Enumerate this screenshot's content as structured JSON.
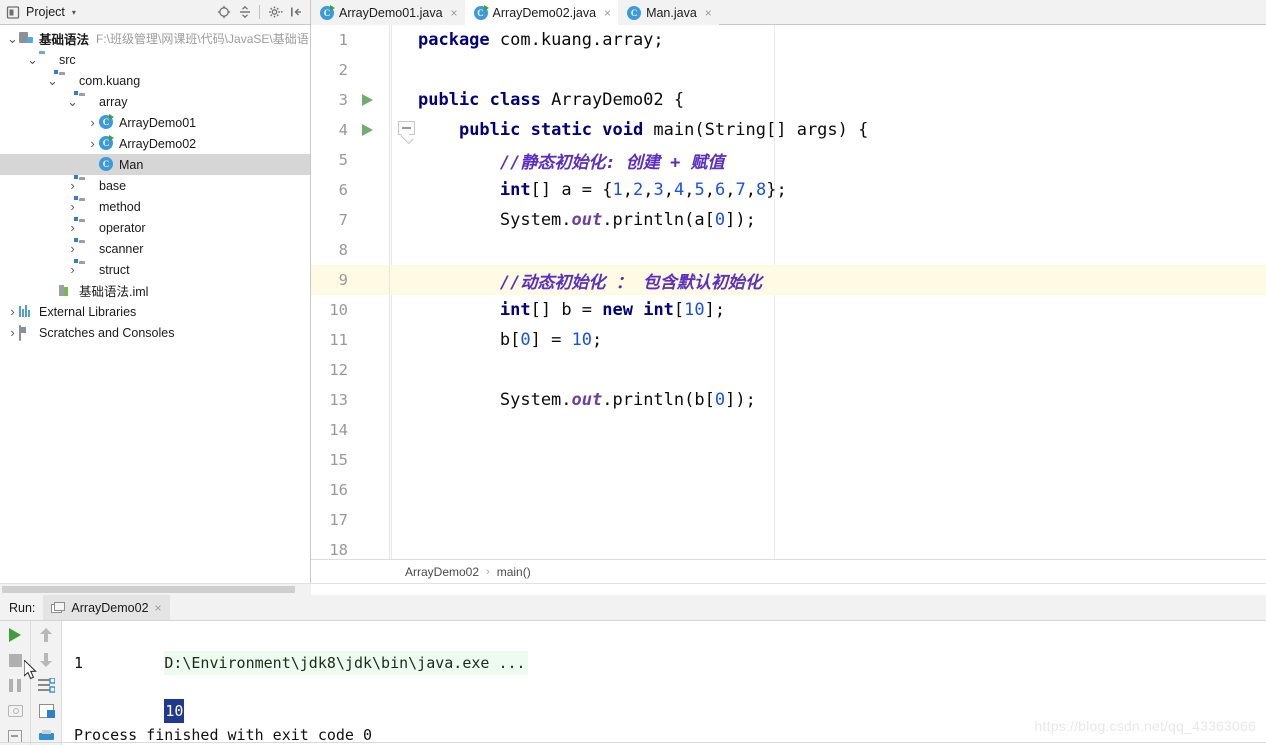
{
  "project_panel": {
    "title": "Project",
    "caret": "▾",
    "icons": [
      "project-view-icon",
      "locate-icon",
      "collapse-all-icon",
      "settings-gear-icon",
      "hide-panel-icon"
    ],
    "tree": [
      {
        "label": "基础语法",
        "path": "F:\\班级管理\\网课班\\代码\\JavaSE\\基础语",
        "icon": "project-root-icon",
        "arrow": "⌄",
        "depth": 0,
        "bold": true,
        "selected": false
      },
      {
        "label": "src",
        "icon": "source-folder-icon",
        "arrow": "⌄",
        "depth": 1,
        "bold": false,
        "selected": false
      },
      {
        "label": "com.kuang",
        "icon": "package-icon",
        "arrow": "⌄",
        "depth": 2,
        "bold": false,
        "selected": false
      },
      {
        "label": "array",
        "icon": "package-icon",
        "arrow": "⌄",
        "depth": 3,
        "bold": false,
        "selected": false
      },
      {
        "label": "ArrayDemo01",
        "icon": "java-class-runnable-icon",
        "arrow": "›",
        "depth": 4,
        "bold": false,
        "selected": false
      },
      {
        "label": "ArrayDemo02",
        "icon": "java-class-runnable-icon",
        "arrow": "›",
        "depth": 4,
        "bold": false,
        "selected": false
      },
      {
        "label": "Man",
        "icon": "java-class-icon",
        "arrow": "",
        "depth": 4,
        "bold": false,
        "selected": true
      },
      {
        "label": "base",
        "icon": "package-icon",
        "arrow": "›",
        "depth": 3,
        "bold": false,
        "selected": false
      },
      {
        "label": "method",
        "icon": "package-icon",
        "arrow": "›",
        "depth": 3,
        "bold": false,
        "selected": false
      },
      {
        "label": "operator",
        "icon": "package-icon",
        "arrow": "›",
        "depth": 3,
        "bold": false,
        "selected": false
      },
      {
        "label": "scanner",
        "icon": "package-icon",
        "arrow": "›",
        "depth": 3,
        "bold": false,
        "selected": false
      },
      {
        "label": "struct",
        "icon": "package-icon",
        "arrow": "›",
        "depth": 3,
        "bold": false,
        "selected": false
      },
      {
        "label": "基础语法.iml",
        "icon": "iml-file-icon",
        "arrow": "",
        "depth": 2,
        "bold": false,
        "selected": false
      },
      {
        "label": "External Libraries",
        "icon": "libraries-icon",
        "arrow": "›",
        "depth": 0,
        "bold": false,
        "selected": false
      },
      {
        "label": "Scratches and Consoles",
        "icon": "scratches-icon",
        "arrow": "›",
        "depth": 0,
        "bold": false,
        "selected": false
      }
    ]
  },
  "editor_tabs": [
    {
      "label": "ArrayDemo01.java",
      "icon": "java-class-runnable-icon",
      "active": false,
      "close": "×"
    },
    {
      "label": "ArrayDemo02.java",
      "icon": "java-class-runnable-icon",
      "active": true,
      "close": "×"
    },
    {
      "label": "Man.java",
      "icon": "java-class-icon",
      "active": false,
      "close": "×"
    }
  ],
  "editor": {
    "current_line": 9,
    "line_numbers": [
      "1",
      "2",
      "3",
      "4",
      "5",
      "6",
      "7",
      "8",
      "9",
      "10",
      "11",
      "12",
      "13",
      "14",
      "15",
      "16",
      "17",
      "18"
    ],
    "run_markers": [
      3,
      4
    ],
    "fold_marker_line": 4,
    "lines": [
      {
        "n": "1",
        "tokens": [
          {
            "t": "package ",
            "c": "kw"
          },
          {
            "t": "com.kuang.array;",
            "c": ""
          }
        ]
      },
      {
        "n": "2",
        "tokens": []
      },
      {
        "n": "3",
        "tokens": [
          {
            "t": "public class ",
            "c": "kw"
          },
          {
            "t": "ArrayDemo02 {",
            "c": ""
          }
        ]
      },
      {
        "n": "4",
        "tokens": [
          {
            "t": "    ",
            "c": ""
          },
          {
            "t": "public static void ",
            "c": "kw"
          },
          {
            "t": "main(String[] args) {",
            "c": ""
          }
        ]
      },
      {
        "n": "5",
        "tokens": [
          {
            "t": "        ",
            "c": ""
          },
          {
            "t": "//静态初始化: 创建 + 赋值",
            "c": "cmt"
          }
        ]
      },
      {
        "n": "6",
        "tokens": [
          {
            "t": "        ",
            "c": ""
          },
          {
            "t": "int",
            "c": "kw"
          },
          {
            "t": "[] a = {",
            "c": ""
          },
          {
            "t": "1",
            "c": "num"
          },
          {
            "t": ",",
            "c": ""
          },
          {
            "t": "2",
            "c": "num"
          },
          {
            "t": ",",
            "c": ""
          },
          {
            "t": "3",
            "c": "num"
          },
          {
            "t": ",",
            "c": ""
          },
          {
            "t": "4",
            "c": "num"
          },
          {
            "t": ",",
            "c": ""
          },
          {
            "t": "5",
            "c": "num"
          },
          {
            "t": ",",
            "c": ""
          },
          {
            "t": "6",
            "c": "num"
          },
          {
            "t": ",",
            "c": ""
          },
          {
            "t": "7",
            "c": "num"
          },
          {
            "t": ",",
            "c": ""
          },
          {
            "t": "8",
            "c": "num"
          },
          {
            "t": "};",
            "c": ""
          }
        ]
      },
      {
        "n": "7",
        "tokens": [
          {
            "t": "        System.",
            "c": ""
          },
          {
            "t": "out",
            "c": "fld"
          },
          {
            "t": ".println(a[",
            "c": ""
          },
          {
            "t": "0",
            "c": "num"
          },
          {
            "t": "]);",
            "c": ""
          }
        ]
      },
      {
        "n": "8",
        "tokens": []
      },
      {
        "n": "9",
        "tokens": [
          {
            "t": "        ",
            "c": ""
          },
          {
            "t": "//动态初始化 ： 包含默认初始化",
            "c": "cmt"
          }
        ]
      },
      {
        "n": "10",
        "tokens": [
          {
            "t": "        ",
            "c": ""
          },
          {
            "t": "int",
            "c": "kw"
          },
          {
            "t": "[] b = ",
            "c": ""
          },
          {
            "t": "new int",
            "c": "kw"
          },
          {
            "t": "[",
            "c": ""
          },
          {
            "t": "10",
            "c": "num"
          },
          {
            "t": "];",
            "c": ""
          }
        ]
      },
      {
        "n": "11",
        "tokens": [
          {
            "t": "        b[",
            "c": ""
          },
          {
            "t": "0",
            "c": "num"
          },
          {
            "t": "] = ",
            "c": ""
          },
          {
            "t": "10",
            "c": "num"
          },
          {
            "t": ";",
            "c": ""
          }
        ]
      },
      {
        "n": "12",
        "tokens": []
      },
      {
        "n": "13",
        "tokens": [
          {
            "t": "        System.",
            "c": ""
          },
          {
            "t": "out",
            "c": "fld"
          },
          {
            "t": ".println(b[",
            "c": ""
          },
          {
            "t": "0",
            "c": "num"
          },
          {
            "t": "]);",
            "c": ""
          }
        ]
      },
      {
        "n": "14",
        "tokens": []
      },
      {
        "n": "15",
        "tokens": []
      },
      {
        "n": "16",
        "tokens": []
      },
      {
        "n": "17",
        "tokens": []
      },
      {
        "n": "18",
        "tokens": []
      }
    ],
    "breadcrumb": {
      "class": "ArrayDemo02",
      "separator": "›",
      "method": "main()"
    }
  },
  "run_panel": {
    "label": "Run:",
    "tab": {
      "label": "ArrayDemo02",
      "close": "×",
      "icon": "run-configuration-icon"
    },
    "toolbar_left": [
      "rerun-icon",
      "stop-icon",
      "pause-icon",
      "camera-icon",
      "exit-icon"
    ],
    "toolbar_right": [
      "up-arrow-icon",
      "down-arrow-icon",
      "soft-wrap-icon",
      "scroll-to-end-icon",
      "print-icon"
    ],
    "console": {
      "command": "D:\\Environment\\jdk8\\jdk\\bin\\java.exe ...",
      "output_1": "1",
      "output_2_selected": "10",
      "blank": "",
      "status": "Process finished with exit code 0"
    }
  },
  "watermark": "https://blog.csdn.net/qq_43363066",
  "colors": {
    "keyword": "#000080",
    "number": "#1750eb",
    "comment": "#5a2fc2",
    "current_line_highlight": "#fffae3",
    "selection": "#20398f",
    "run_green": "#3f9f3f",
    "tree_selection": "#d6d6d6"
  }
}
